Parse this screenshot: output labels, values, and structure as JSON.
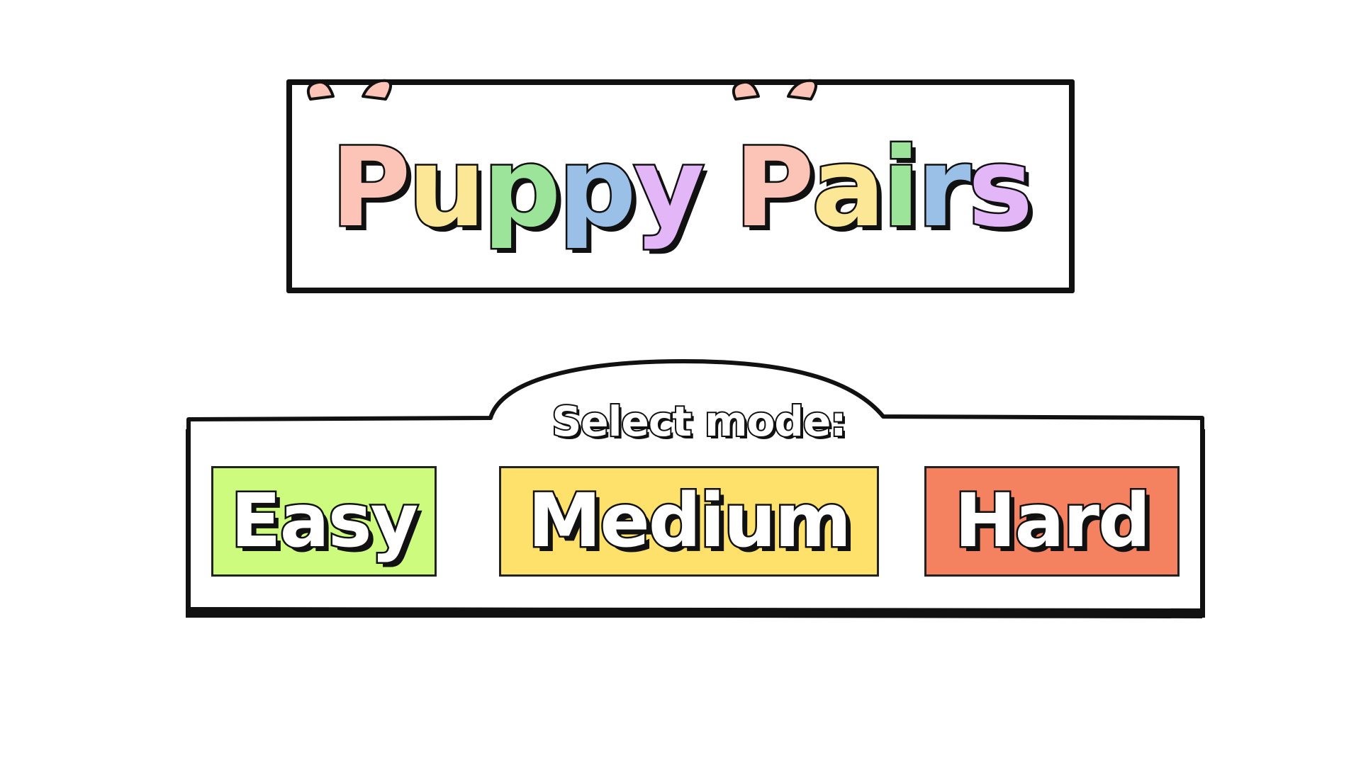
{
  "title": {
    "word1": [
      "P",
      "u",
      "p",
      "p",
      "y"
    ],
    "word2": [
      "P",
      "a",
      "i",
      "r",
      "s"
    ],
    "letter_colors": [
      "#fcc4b6",
      "#fbe795",
      "#9ce49a",
      "#9bc0e7",
      "#e2b6f7"
    ]
  },
  "mode_select": {
    "label": "Select mode:",
    "buttons": [
      {
        "id": "easy",
        "label": "Easy",
        "color": "#ccfb7e"
      },
      {
        "id": "medium",
        "label": "Medium",
        "color": "#fde16a"
      },
      {
        "id": "hard",
        "label": "Hard",
        "color": "#f48160"
      }
    ]
  },
  "colors": {
    "outline": "#111111",
    "background": "#ffffff"
  }
}
